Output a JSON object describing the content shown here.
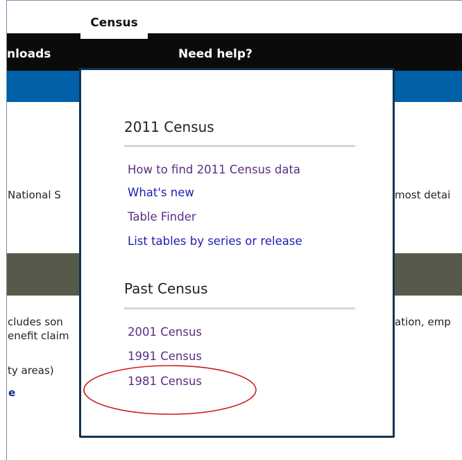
{
  "nav": {
    "downloads_partial": "nloads",
    "census_tab": "Census",
    "need_help": "Need help?"
  },
  "background": {
    "national_partial": "National S",
    "most_detail_partial": "most detai",
    "includes_partial": "cludes son",
    "ation_partial": "ation, emp",
    "benefit_partial": "enefit claim",
    "areas_partial": "ty areas)",
    "link_partial": "e"
  },
  "dropdown": {
    "census_2011": {
      "heading": "2011 Census",
      "links": [
        {
          "label": "How to find 2011 Census data",
          "state": "visited"
        },
        {
          "label": "What's new",
          "state": "unvisited"
        },
        {
          "label": "Table Finder",
          "state": "visited"
        },
        {
          "label": "List tables by series or release",
          "state": "unvisited"
        }
      ]
    },
    "past_census": {
      "heading": "Past Census",
      "links": [
        {
          "label": "2001 Census",
          "state": "visited"
        },
        {
          "label": "1991 Census",
          "state": "visited"
        },
        {
          "label": "1981 Census",
          "state": "visited",
          "highlighted": true
        }
      ]
    }
  },
  "colors": {
    "visited_link": "#5a2d82",
    "unvisited_link": "#1c1cb0",
    "highlight_ellipse": "#d01818",
    "nav_bg": "#0b0b0b",
    "blue_bar": "#0060a8",
    "olive_bar": "#575a4b"
  }
}
